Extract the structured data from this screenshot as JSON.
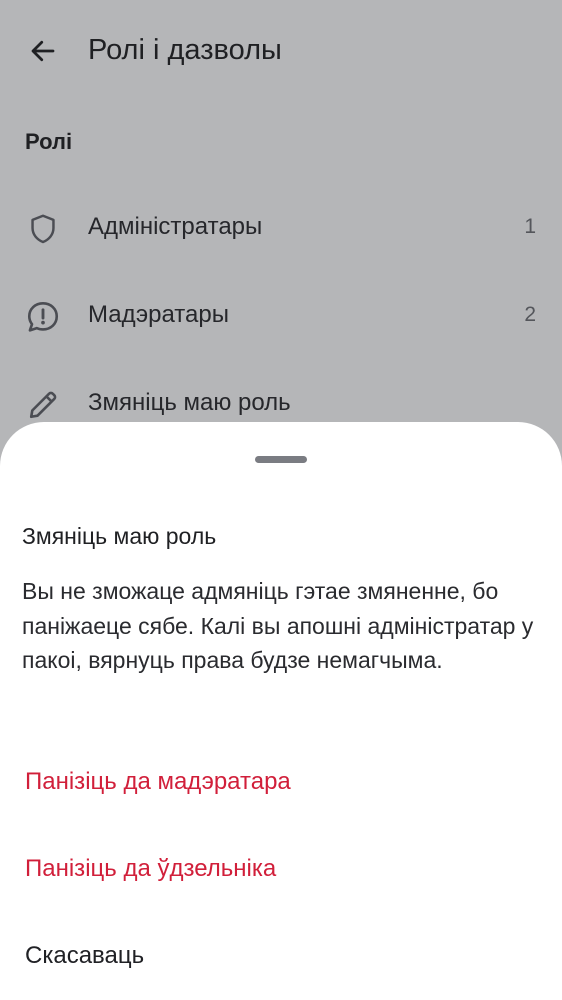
{
  "header": {
    "title": "Ролі і дазволы",
    "back_icon": "arrow-left-icon"
  },
  "roles_section": {
    "header": "Ролі",
    "items": [
      {
        "label": "Адміністратары",
        "count": "1",
        "icon": "shield-icon"
      },
      {
        "label": "Мадэратары",
        "count": "2",
        "icon": "speech-bubble-exclamation-icon"
      },
      {
        "label": "Змяніць маю роль",
        "count": "",
        "icon": "pencil-icon"
      }
    ]
  },
  "sheet": {
    "title": "Змяніць маю роль",
    "message": "Вы не зможаце адмяніць гэтае змяненне, бо паніжаеце сябе. Калі вы апошні адміністратар у пакоі, вярнуць права будзе немагчыма.",
    "actions": [
      {
        "label": "Панізіць да мадэратара",
        "style": "danger"
      },
      {
        "label": "Панізіць да ўдзельніка",
        "style": "danger"
      },
      {
        "label": "Скасаваць",
        "style": "neutral"
      }
    ]
  },
  "colors": {
    "scrim_background": "#b5b6b8",
    "danger": "#d11f3a",
    "sheet_background": "#ffffff",
    "handle": "#7a7c82"
  }
}
